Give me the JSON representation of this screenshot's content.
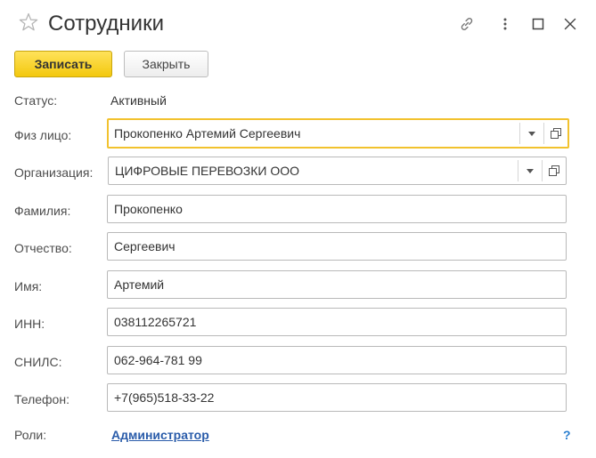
{
  "window": {
    "title": "Сотрудники",
    "icons": [
      "star-icon",
      "link-icon",
      "more-icon",
      "maximize-icon",
      "close-icon"
    ]
  },
  "toolbar": {
    "save_label": "Записать",
    "close_label": "Закрыть"
  },
  "form": {
    "status_label": "Статус:",
    "status_value": "Активный",
    "person_label": "Физ лицо:",
    "person_value": "Прокопенко Артемий Сергеевич",
    "org_label": "Организация:",
    "org_value": "ЦИФРОВЫЕ ПЕРЕВОЗКИ ООО",
    "lastname_label": "Фамилия:",
    "lastname_value": "Прокопенко",
    "patronymic_label": "Отчество:",
    "patronymic_value": "Сергеевич",
    "firstname_label": "Имя:",
    "firstname_value": "Артемий",
    "inn_label": "ИНН:",
    "inn_value": "038112265721",
    "snils_label": "СНИЛС:",
    "snils_value": "062-964-781 99",
    "phone_label": "Телефон:",
    "phone_value": "+7(965)518-33-22",
    "roles_label": "Роли:",
    "roles_value": "Администратор",
    "help_label": "?"
  },
  "colors": {
    "primary_button": "#f3c80e",
    "focus_border": "#f2c22e",
    "link": "#2a5caa",
    "help": "#2a7fd0"
  }
}
